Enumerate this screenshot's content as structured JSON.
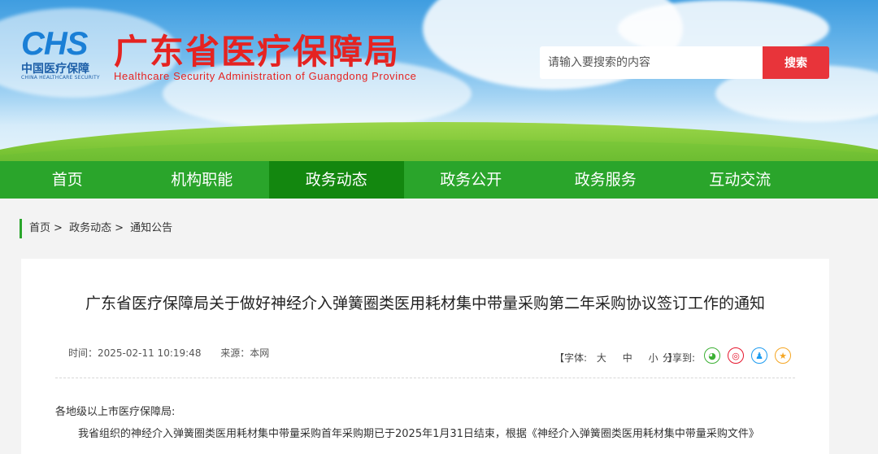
{
  "header": {
    "logo_text": "CHS",
    "logo_cn": "中国医疗保障",
    "logo_en": "CHINA HEALTHCARE SECURITY",
    "site_title": "广东省医疗保障局",
    "site_subtitle": "Healthcare Security Administration of Guangdong Province",
    "search_placeholder": "请输入要搜索的内容",
    "search_button": "搜索"
  },
  "nav": {
    "items": [
      {
        "label": "首页"
      },
      {
        "label": "机构职能"
      },
      {
        "label": "政务动态"
      },
      {
        "label": "政务公开"
      },
      {
        "label": "政务服务"
      },
      {
        "label": "互动交流"
      }
    ],
    "active_index": 2
  },
  "breadcrumb": {
    "items": [
      "首页",
      "政务动态",
      "通知公告"
    ],
    "separator": ">"
  },
  "article": {
    "title": "广东省医疗保障局关于做好神经介入弹簧圈类医用耗材集中带量采购第二年采购协议签订工作的通知",
    "time": "时间：2025-02-11 10:19:48",
    "source": "来源：本网",
    "font_label_open": "【字体:",
    "font_large": "大",
    "font_medium": "中",
    "font_small": "小",
    "font_label_close": "】",
    "share_label": "分享到:",
    "salutation": "各地级以上市医疗保障局:",
    "paragraph1": "我省组织的神经介入弹簧圈类医用耗材集中带量采购首年采购期已于2025年1月31日结束，根据《神经介入弹簧圈类医用耗材集中带量采购文件》"
  },
  "share_icons": [
    {
      "name": "wechat-icon",
      "color": "#3cb034",
      "glyph": "◕"
    },
    {
      "name": "weibo-icon",
      "color": "#e6162d",
      "glyph": "◎"
    },
    {
      "name": "qq-icon",
      "color": "#1d9bf0",
      "glyph": "♟"
    },
    {
      "name": "qzone-icon",
      "color": "#f5a623",
      "glyph": "★"
    }
  ],
  "colors": {
    "brand_green": "#2aa52b",
    "nav_active": "#13870f",
    "title_red": "#e52321",
    "search_red": "#e8343a",
    "logo_blue": "#1a7fd6"
  }
}
